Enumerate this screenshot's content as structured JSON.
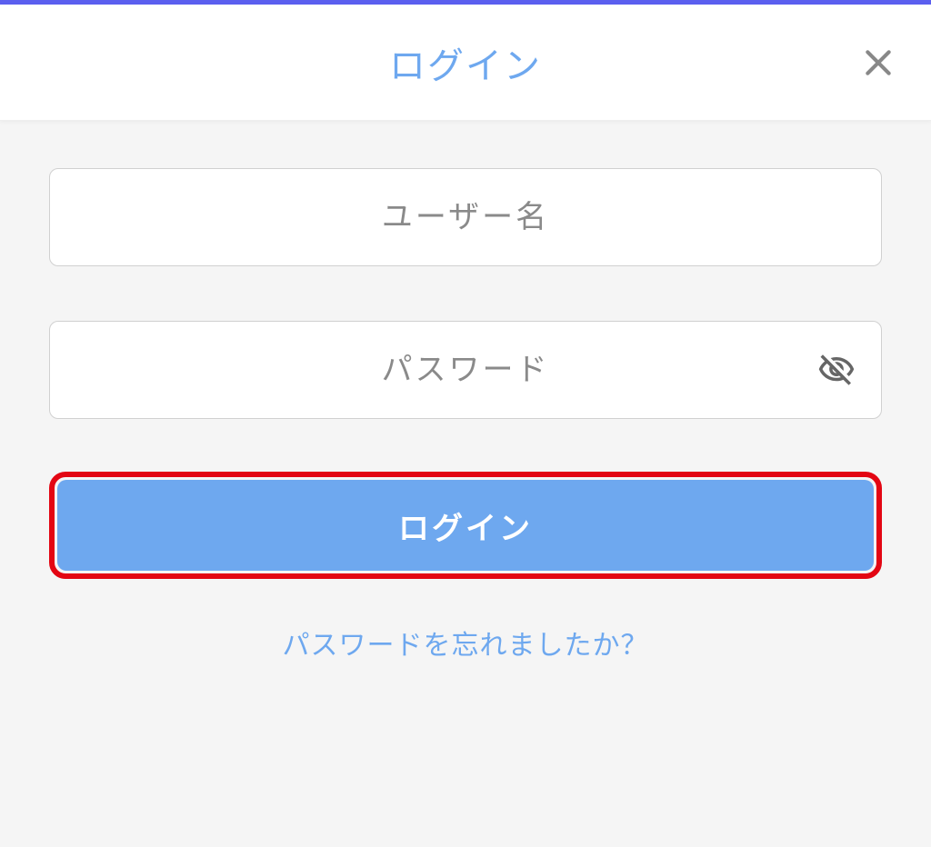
{
  "header": {
    "title": "ログイン"
  },
  "form": {
    "username_placeholder": "ユーザー名",
    "username_value": "",
    "password_placeholder": "パスワード",
    "password_value": "",
    "login_button_label": "ログイン",
    "forgot_password_label": "パスワードを忘れましたか？"
  },
  "colors": {
    "accent": "#6ea8ef",
    "top_bar": "#5b5fef",
    "highlight_border": "#e30613"
  }
}
